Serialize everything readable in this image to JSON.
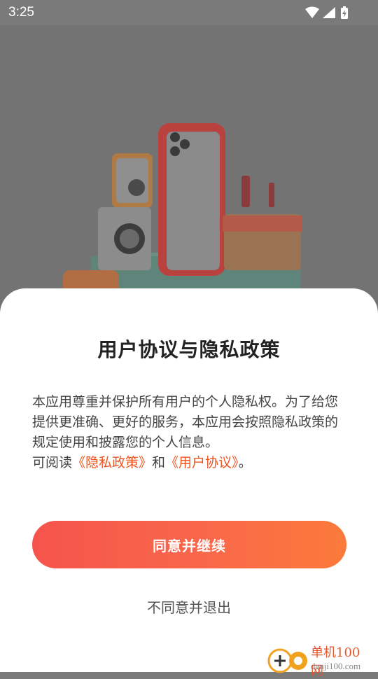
{
  "status_bar": {
    "time": "3:25"
  },
  "dialog": {
    "title": "用户协议与隐私政策",
    "body_text": "本应用尊重并保护所有用户的个人隐私权。为了给您提供更准确、更好的服务，本应用会按照隐私政策的规定使用和披露您的个人信息。",
    "read_prefix": "可阅读",
    "privacy_link": "《隐私政策》",
    "and_text": "和",
    "terms_link": "《用户协议》",
    "end_period": "。",
    "agree_button": "同意并继续",
    "decline_button": "不同意并退出"
  },
  "watermark": {
    "name": "单机100网",
    "url": "danji100.com"
  },
  "colors": {
    "accent": "#f0541f",
    "button_start": "#f5544c",
    "button_end": "#fb7a3a"
  }
}
